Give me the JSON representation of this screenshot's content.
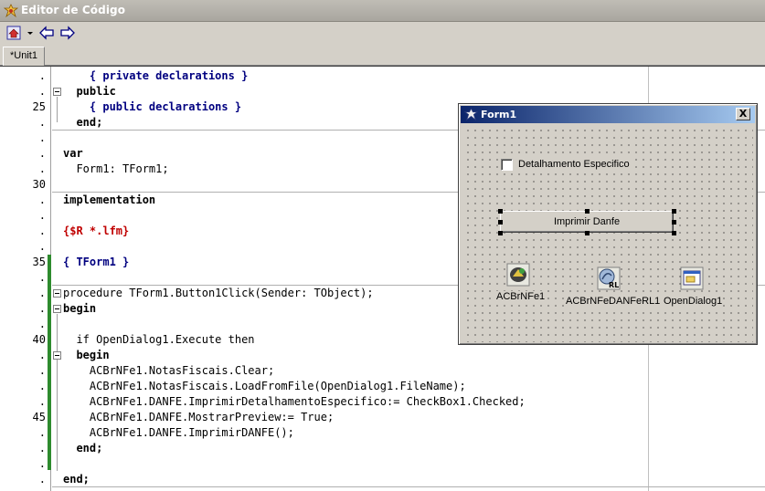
{
  "window": {
    "title": "Editor de Código"
  },
  "toolbar": {
    "icons": [
      "home-icon",
      "dropdown-arrow-icon",
      "back-arrow-icon",
      "forward-arrow-icon"
    ]
  },
  "tabs": [
    {
      "label": "*Unit1",
      "active": true
    }
  ],
  "gutter": {
    "numbers": [
      ".",
      ".",
      "25",
      ".",
      ".",
      ".",
      ".",
      "30",
      ".",
      ".",
      ".",
      ".",
      "35",
      ".",
      ".",
      ".",
      ".",
      "40",
      ".",
      ".",
      ".",
      ".",
      "45",
      ".",
      ".",
      ".",
      "."
    ]
  },
  "code": {
    "lines": [
      "    { private declarations }",
      "  public",
      "    { public declarations }",
      "  end;",
      "",
      "var",
      "  Form1: TForm1;",
      "",
      "implementation",
      "",
      "{$R *.lfm}",
      "",
      "{ TForm1 }",
      "",
      "procedure TForm1.Button1Click(Sender: TObject);",
      "begin",
      "",
      "  if OpenDialog1.Execute then",
      "  begin",
      "    ACBrNFe1.NotasFiscais.Clear;",
      "    ACBrNFe1.NotasFiscais.LoadFromFile(OpenDialog1.FileName);",
      "    ACBrNFe1.DANFE.ImprimirDetalhamentoEspecifico:= CheckBox1.Checked;",
      "    ACBrNFe1.DANFE.MostrarPreview:= True;",
      "    ACBrNFe1.DANFE.ImprimirDANFE();",
      "  end;",
      "",
      "end;"
    ]
  },
  "form": {
    "title": "Form1",
    "close_label": "X",
    "checkbox_label": "Detalhamento Especifico",
    "checkbox_checked": false,
    "button_label": "Imprimir Danfe",
    "components": [
      {
        "label": "ACBrNFe1",
        "icon": "acbr-nfe-component-icon"
      },
      {
        "label": "ACBrNFeDANFeRL1",
        "icon": "acbr-danfe-rl-component-icon"
      },
      {
        "label": "OpenDialog1",
        "icon": "open-dialog-component-icon"
      }
    ]
  },
  "colors": {
    "keyword": "#000000",
    "comment": "#000080",
    "directive": "#c00000",
    "symbol": "#c00000",
    "change_bar": "#2e8b2e",
    "form_title_start": "#0a246a",
    "form_title_end": "#a6caf0"
  }
}
